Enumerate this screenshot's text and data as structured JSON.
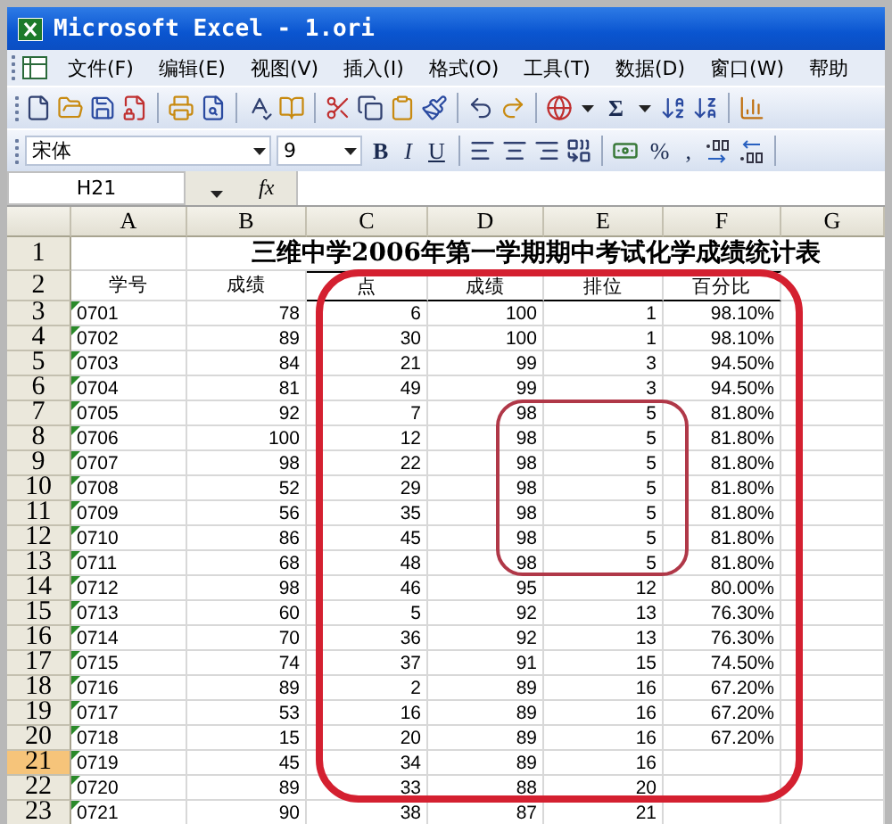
{
  "window": {
    "title": "Microsoft Excel - 1.ori"
  },
  "menu": [
    "文件(F)",
    "编辑(E)",
    "视图(V)",
    "插入(I)",
    "格式(O)",
    "工具(T)",
    "数据(D)",
    "窗口(W)",
    "帮助"
  ],
  "standard_bar": {
    "sum_label": "Σ"
  },
  "format_bar": {
    "font": "宋体",
    "size": "9",
    "style_buttons": [
      "B",
      "I",
      "U"
    ],
    "number_buttons": [
      "%",
      ","
    ]
  },
  "formula_bar": {
    "name_box": "H21",
    "function_label": "fx"
  },
  "columns": [
    "A",
    "B",
    "C",
    "D",
    "E",
    "F",
    "G"
  ],
  "title_row": {
    "header": "1",
    "title": "三维中学2006年第一学期期中考试化学成绩统计表"
  },
  "rows": [
    {
      "header": "2",
      "kind": "header",
      "active": false,
      "cells": [
        "学号",
        "成绩",
        "点",
        "成绩",
        "排位",
        "百分比"
      ]
    },
    {
      "header": "3",
      "kind": "data",
      "active": false,
      "cells": [
        "0701",
        "78",
        "6",
        "100",
        "1",
        "98.10%"
      ]
    },
    {
      "header": "4",
      "kind": "data",
      "active": false,
      "cells": [
        "0702",
        "89",
        "30",
        "100",
        "1",
        "98.10%"
      ]
    },
    {
      "header": "5",
      "kind": "data",
      "active": false,
      "cells": [
        "0703",
        "84",
        "21",
        "99",
        "3",
        "94.50%"
      ]
    },
    {
      "header": "6",
      "kind": "data",
      "active": false,
      "cells": [
        "0704",
        "81",
        "49",
        "99",
        "3",
        "94.50%"
      ]
    },
    {
      "header": "7",
      "kind": "data",
      "active": false,
      "cells": [
        "0705",
        "92",
        "7",
        "98",
        "5",
        "81.80%"
      ]
    },
    {
      "header": "8",
      "kind": "data",
      "active": false,
      "cells": [
        "0706",
        "100",
        "12",
        "98",
        "5",
        "81.80%"
      ]
    },
    {
      "header": "9",
      "kind": "data",
      "active": false,
      "cells": [
        "0707",
        "98",
        "22",
        "98",
        "5",
        "81.80%"
      ]
    },
    {
      "header": "10",
      "kind": "data",
      "active": false,
      "cells": [
        "0708",
        "52",
        "29",
        "98",
        "5",
        "81.80%"
      ]
    },
    {
      "header": "11",
      "kind": "data",
      "active": false,
      "cells": [
        "0709",
        "56",
        "35",
        "98",
        "5",
        "81.80%"
      ]
    },
    {
      "header": "12",
      "kind": "data",
      "active": false,
      "cells": [
        "0710",
        "86",
        "45",
        "98",
        "5",
        "81.80%"
      ]
    },
    {
      "header": "13",
      "kind": "data",
      "active": false,
      "cells": [
        "0711",
        "68",
        "48",
        "98",
        "5",
        "81.80%"
      ]
    },
    {
      "header": "14",
      "kind": "data",
      "active": false,
      "cells": [
        "0712",
        "98",
        "46",
        "95",
        "12",
        "80.00%"
      ]
    },
    {
      "header": "15",
      "kind": "data",
      "active": false,
      "cells": [
        "0713",
        "60",
        "5",
        "92",
        "13",
        "76.30%"
      ]
    },
    {
      "header": "16",
      "kind": "data",
      "active": false,
      "cells": [
        "0714",
        "70",
        "36",
        "92",
        "13",
        "76.30%"
      ]
    },
    {
      "header": "17",
      "kind": "data",
      "active": false,
      "cells": [
        "0715",
        "74",
        "37",
        "91",
        "15",
        "74.50%"
      ]
    },
    {
      "header": "18",
      "kind": "data",
      "active": false,
      "cells": [
        "0716",
        "89",
        "2",
        "89",
        "16",
        "67.20%"
      ]
    },
    {
      "header": "19",
      "kind": "data",
      "active": false,
      "cells": [
        "0717",
        "53",
        "16",
        "89",
        "16",
        "67.20%"
      ]
    },
    {
      "header": "20",
      "kind": "data",
      "active": false,
      "cells": [
        "0718",
        "15",
        "20",
        "89",
        "16",
        "67.20%"
      ]
    },
    {
      "header": "21",
      "kind": "data",
      "active": true,
      "cells": [
        "0719",
        "45",
        "34",
        "89",
        "16",
        null
      ]
    },
    {
      "header": "22",
      "kind": "data",
      "active": false,
      "cells": [
        "0720",
        "89",
        "33",
        "88",
        "20",
        null
      ]
    },
    {
      "header": "23",
      "kind": "data",
      "active": false,
      "cells": [
        "0721",
        "90",
        "38",
        "87",
        "21",
        null
      ]
    }
  ]
}
